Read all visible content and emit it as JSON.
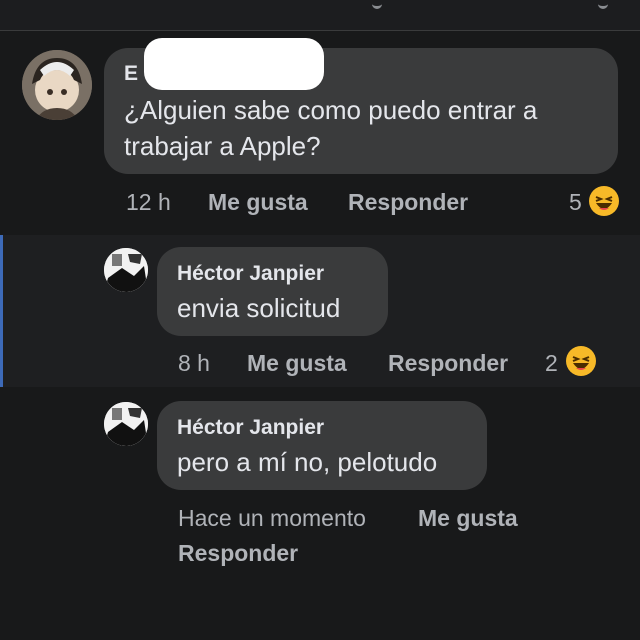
{
  "comments": [
    {
      "author": "E",
      "text_lines": [
        "¿Alguien sabe como puedo entrar a",
        "trabajar a Apple?"
      ],
      "time": "12 h",
      "like_label": "Me gusta",
      "reply_label": "Responder",
      "reaction_count": "5",
      "reaction_icon": "laugh-emoji-icon"
    },
    {
      "author": "Héctor Janpier",
      "text": "envia solicitud",
      "time": "8 h",
      "like_label": "Me gusta",
      "reply_label": "Responder",
      "reaction_count": "2",
      "reaction_icon": "laugh-emoji-icon"
    },
    {
      "author": "Héctor Janpier",
      "text": "pero a mí no, pelotudo",
      "time": "Hace un momento",
      "like_label": "Me gusta",
      "reply_label": "Responder"
    }
  ],
  "colors": {
    "background": "#18191a",
    "bubble": "#3a3b3c",
    "text": "#e4e6eb",
    "meta": "#b0b3b8",
    "reaction": "#f7b928",
    "highlight_bar": "#3d6ab8"
  }
}
